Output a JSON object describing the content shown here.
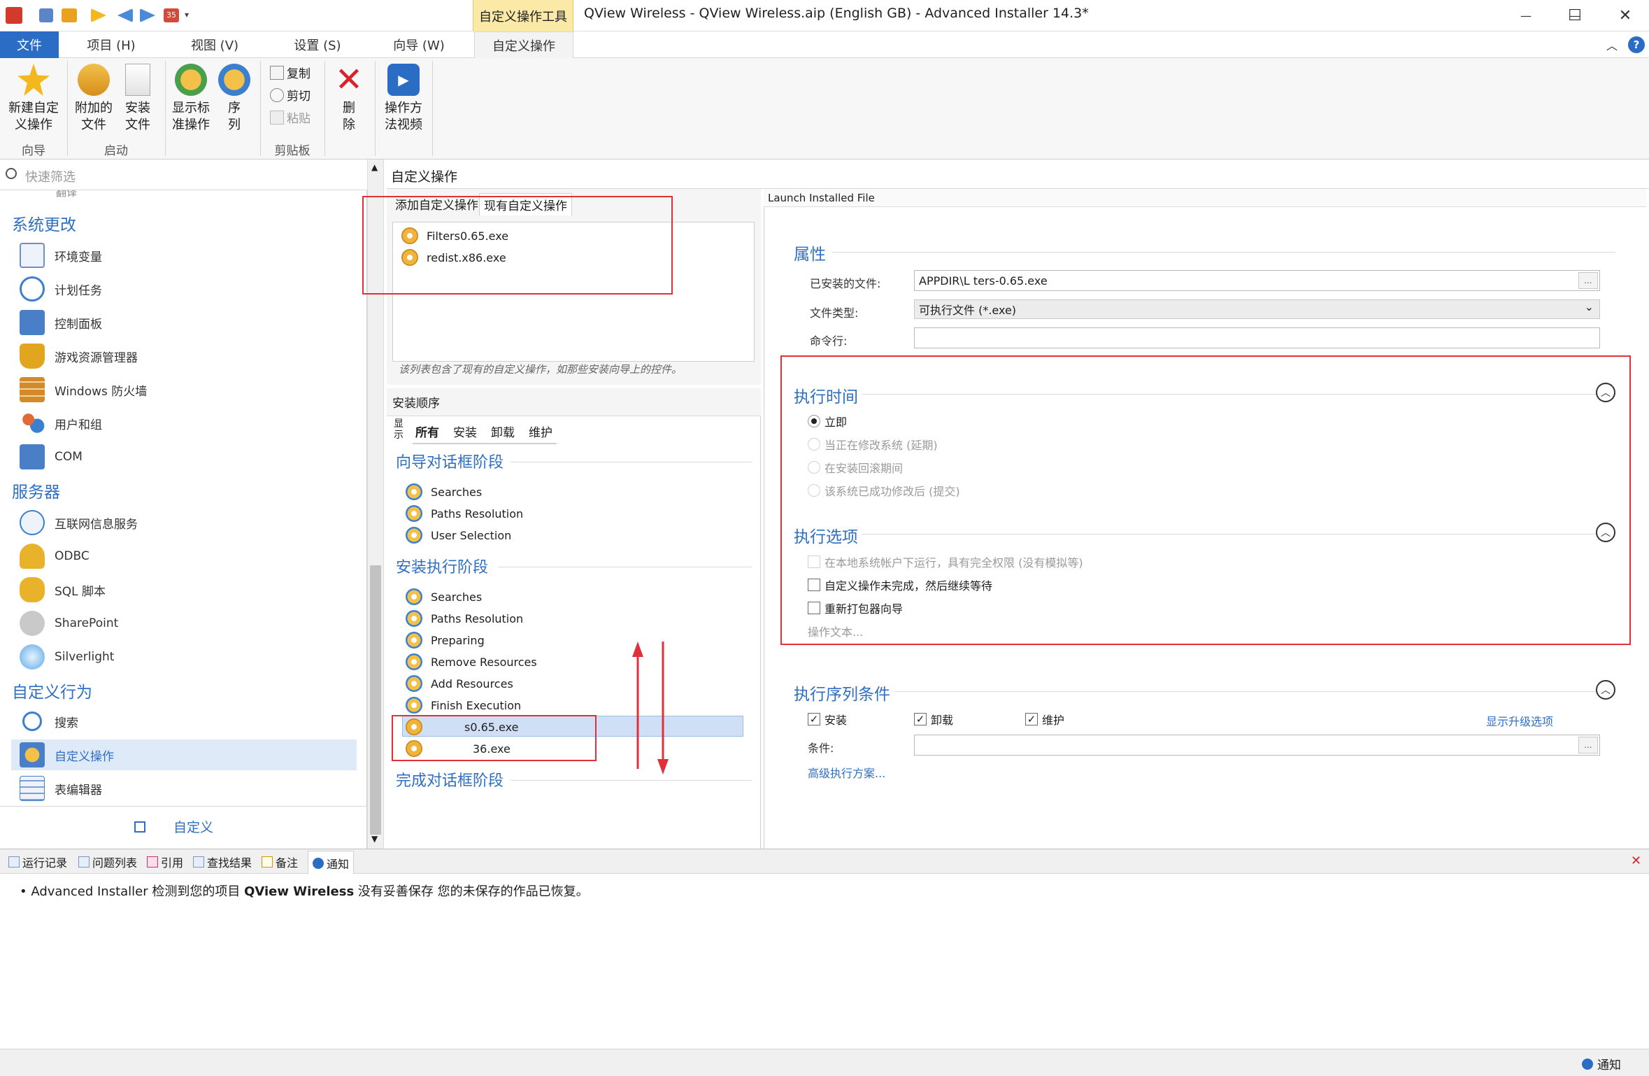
{
  "titlebar": {
    "context_tab_header": "自定义操作工具",
    "window_title": "QView Wireless - QView Wireless.aip (English GB) - Advanced Installer 14.3*",
    "quick_badge": "35",
    "minimize": "—",
    "maximize": "☐",
    "close": "✕"
  },
  "ribbon_tabs": {
    "file": "文件",
    "project": "项目 (H)",
    "view": "视图 (V)",
    "settings": "设置 (S)",
    "wizard": "向导 (W)",
    "custom_actions": "自定义操作",
    "collapse_glyph": "︿",
    "help_glyph": "?"
  },
  "ribbon": {
    "new_custom_action": "新建自定\n义操作",
    "attached_file": "附加的\n文件",
    "install_file": "安装\n文件",
    "show_standard": "显示标\n准操作",
    "sequence": "序\n列",
    "copy": "复制",
    "cut": "剪切",
    "paste": "粘贴",
    "delete": "删\n除",
    "video": "操作方\n法视频",
    "group_wizard": "向导",
    "group_launch": "启动",
    "group_clipboard": "剪贴板"
  },
  "left": {
    "filter_placeholder": "快速筛选",
    "partial_item": "翻译",
    "section_system": "系统更改",
    "env_vars": "环境变量",
    "scheduled_tasks": "计划任务",
    "control_panel": "控制面板",
    "game_explorer": "游戏资源管理器",
    "firewall": "Windows 防火墙",
    "users_groups": "用户和组",
    "com": "COM",
    "section_server": "服务器",
    "iis": "互联网信息服务",
    "odbc": "ODBC",
    "sql": "SQL 脚本",
    "sharepoint": "SharePoint",
    "silverlight": "Silverlight",
    "section_custom": "自定义行为",
    "search": "搜索",
    "custom_actions": "自定义操作",
    "table_editor": "表编辑器",
    "customize": "自定义"
  },
  "main": {
    "header": "自定义操作",
    "tab_add": "添加自定义操作",
    "tab_existing": "现有自定义操作",
    "existing_list": [
      "Filters0.65.exe",
      "redist.x86.exe"
    ],
    "hint": "该列表包含了现有的自定义操作，如那些安装向导上的控件。"
  },
  "sequence": {
    "header": "安装顺序",
    "show_label": "显\n示",
    "tabs": [
      "所有",
      "安装",
      "卸载",
      "维护"
    ],
    "stage_wizard": "向导对话框阶段",
    "wizard_rows": [
      "Searches",
      "Paths Resolution",
      "User Selection"
    ],
    "stage_install": "安装执行阶段",
    "install_rows": [
      "Searches",
      "Paths Resolution",
      "Preparing",
      "Remove Resources",
      "Add Resources",
      "Finish Execution",
      "s0.65.exe",
      "36.exe"
    ],
    "stage_finish": "完成对话框阶段"
  },
  "right": {
    "header": "Launch Installed File",
    "sect_properties": "属性",
    "installed_file_label": "已安装的文件:",
    "installed_file_value": "APPDIR\\L        ters-0.65.exe",
    "file_type_label": "文件类型:",
    "file_type_value": "可执行文件 (*.exe)",
    "cmdline_label": "命令行:",
    "cmdline_value": "",
    "sect_exec_time": "执行时间",
    "radio_immediate": "立即",
    "radio_deferred": "当正在修改系统 (延期)",
    "radio_rollback": "在安装回滚期间",
    "radio_commit": "该系统已成功修改后 (提交)",
    "sect_exec_options": "执行选项",
    "chk_local_system": "在本地系统帐户下运行，具有完全权限 (没有模拟等)",
    "chk_wait": "自定义操作未完成，然后继续等待",
    "chk_repackager": "重新打包器向导",
    "action_text": "操作文本...",
    "sect_conditions": "执行序列条件",
    "chk_install": "安装",
    "chk_uninstall": "卸载",
    "chk_maintenance": "维护",
    "show_upgrade": "显示升级选项",
    "condition_label": "条件:",
    "condition_value": "",
    "advanced": "高级执行方案...",
    "ellipsis": "...",
    "check_mark": "✓",
    "collapse_glyph": "︿",
    "dropdown_glyph": "⌄"
  },
  "bottom": {
    "tabs": [
      "运行记录",
      "问题列表",
      "引用",
      "查找结果",
      "备注",
      "通知"
    ],
    "close_glyph": "✕",
    "notice_prefix": "Advanced Installer 检测到您的项目 ",
    "notice_project": "QView Wireless",
    "notice_suffix": " 没有妥善保存 您的未保存的作品已恢复。",
    "status_notice": "通知"
  },
  "colors": {
    "accent": "#2b6cc4",
    "highlight_box": "#e0303a",
    "section_blue": "#2f6fc1"
  }
}
